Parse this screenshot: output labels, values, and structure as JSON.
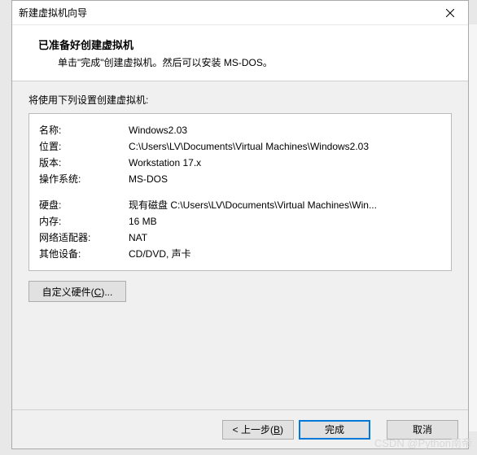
{
  "dialog": {
    "title": "新建虚拟机向导",
    "header_title": "已准备好创建虚拟机",
    "header_subtitle": "单击\"完成\"创建虚拟机。然后可以安装 MS-DOS。"
  },
  "body": {
    "intro": "将使用下列设置创建虚拟机:",
    "rows1": [
      {
        "label": "名称:",
        "value": "Windows2.03"
      },
      {
        "label": "位置:",
        "value": "C:\\Users\\LV\\Documents\\Virtual Machines\\Windows2.03"
      },
      {
        "label": "版本:",
        "value": "Workstation 17.x"
      },
      {
        "label": "操作系统:",
        "value": "MS-DOS"
      }
    ],
    "rows2": [
      {
        "label": "硬盘:",
        "value": "现有磁盘 C:\\Users\\LV\\Documents\\Virtual Machines\\Win..."
      },
      {
        "label": "内存:",
        "value": "16 MB"
      },
      {
        "label": "网络适配器:",
        "value": "NAT"
      },
      {
        "label": "其他设备:",
        "value": "CD/DVD, 声卡"
      }
    ],
    "customize_prefix": "自定义硬件(",
    "customize_key": "C",
    "customize_suffix": ")..."
  },
  "footer": {
    "back_prefix": "< 上一步(",
    "back_key": "B",
    "back_suffix": ")",
    "finish": "完成",
    "cancel": "取消"
  },
  "watermark": "CSDN @Python南帝"
}
